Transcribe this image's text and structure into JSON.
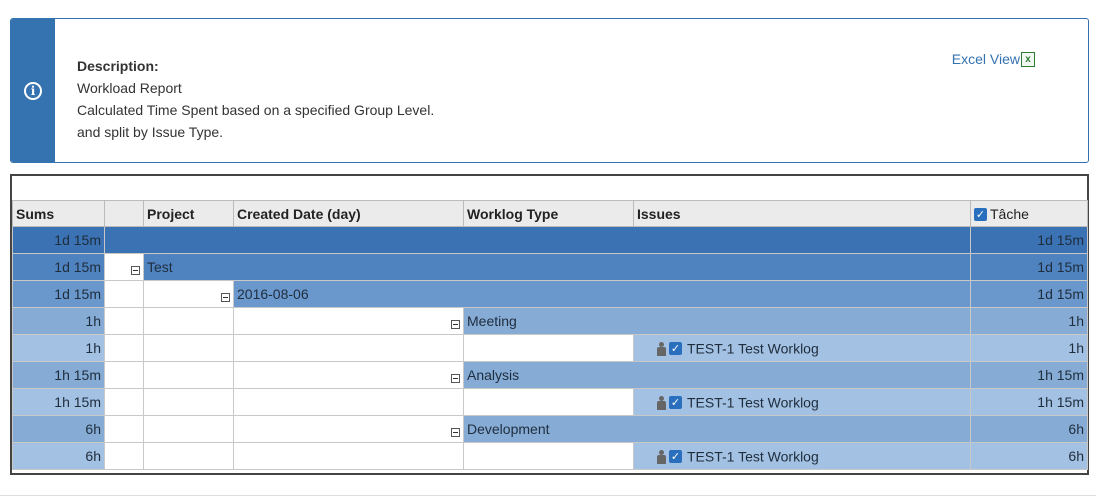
{
  "description": {
    "title": "Description:",
    "lines": [
      "Workload Report",
      "Calculated Time Spent based on a specified Group Level.",
      "and split by Issue Type."
    ],
    "excel_link": "Excel View",
    "excel_icon_letter": "x"
  },
  "table": {
    "headers": {
      "sums": "Sums",
      "blank": "",
      "project": "Project",
      "created": "Created Date (day)",
      "worklog_type": "Worklog Type",
      "issues": "Issues",
      "tache": "Tâche"
    },
    "rows": [
      {
        "sum": "1d 15m",
        "tache": "1d 15m"
      },
      {
        "sum": "1d 15m",
        "label": "Test",
        "tache": "1d 15m"
      },
      {
        "sum": "1d 15m",
        "label": "2016-08-06",
        "tache": "1d 15m"
      },
      {
        "sum": "1h",
        "label": "Meeting",
        "tache": "1h"
      },
      {
        "sum": "1h",
        "label": "TEST-1 Test Worklog",
        "tache": "1h"
      },
      {
        "sum": "1h 15m",
        "label": "Analysis",
        "tache": "1h 15m"
      },
      {
        "sum": "1h 15m",
        "label": "TEST-1 Test Worklog",
        "tache": "1h 15m"
      },
      {
        "sum": "6h",
        "label": "Development",
        "tache": "6h"
      },
      {
        "sum": "6h",
        "label": "TEST-1 Test Worklog",
        "tache": "6h"
      }
    ]
  },
  "colors": {
    "accent": "#3572b0",
    "level0": "#3a72b3",
    "level1": "#4f83bf",
    "level2": "#6a98cc",
    "level3": "#86acd6",
    "level4": "#a3c1e2"
  }
}
